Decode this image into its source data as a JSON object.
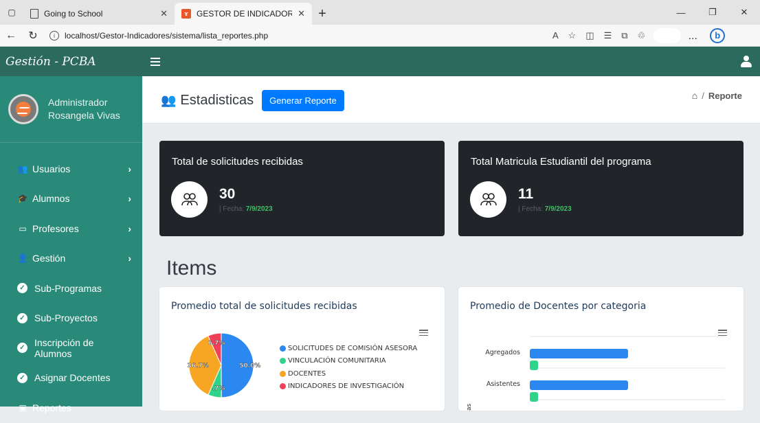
{
  "browser": {
    "tabs": [
      {
        "title": "Going to School",
        "active": false
      },
      {
        "title": "GESTOR DE INDICADORES",
        "active": true
      }
    ],
    "url": "localhost/Gestor-Indicadores/sistema/lista_reportes.php"
  },
  "brand": "Gestión - PCBA",
  "user": {
    "role": "Administrador",
    "name": "Rosangela Vivas"
  },
  "sidebar": {
    "items": [
      {
        "label": "Usuarios"
      },
      {
        "label": "Alumnos"
      },
      {
        "label": "Profesores"
      },
      {
        "label": "Gestión"
      },
      {
        "label": "Sub-Programas"
      },
      {
        "label": "Sub-Proyectos"
      },
      {
        "label": "Inscripción de Alumnos"
      },
      {
        "label": "Asignar Docentes"
      },
      {
        "label": "Reportes"
      }
    ]
  },
  "header": {
    "title": "Estadisticas",
    "generate_button": "Generar Reporte",
    "breadcrumb_sep": "/",
    "breadcrumb_current": "Reporte"
  },
  "stats": [
    {
      "title": "Total de solicitudes recibidas",
      "value": "30",
      "fecha_label": "| Fecha:",
      "date": "7/9/2023"
    },
    {
      "title": "Total Matricula Estudiantil del programa",
      "value": "11",
      "fecha_label": "| Fecha:",
      "date": "7/9/2023"
    }
  ],
  "items_heading": "Items",
  "charts": {
    "pie_title": "Promedio total de solicitudes recibidas",
    "bar_title": "Promedio de Docentes por categoria"
  },
  "chart_data": [
    {
      "type": "pie",
      "title": "Promedio total de solicitudes recibidas",
      "categories": [
        "SOLICITUDES DE COMISIÓN ASESORA",
        "VINCULACIÓN COMUNITARIA",
        "DOCENTES",
        "INDICADORES DE INVESTIGACIÓN"
      ],
      "values": [
        50.0,
        6.7,
        36.7,
        6.7
      ],
      "labels": [
        "50.0%",
        "6.7%",
        "36.7%",
        "6.7%"
      ],
      "colors": [
        "#2b88f0",
        "#2fd38a",
        "#f6a623",
        "#f2405a"
      ]
    },
    {
      "type": "bar",
      "orientation": "horizontal",
      "title": "Promedio de Docentes por categoria",
      "categories": [
        "Agregados",
        "Asistentes"
      ],
      "series": [
        {
          "color": "#2b88f0"
        },
        {
          "color": "#2fd38a"
        }
      ],
      "ylabel_partial": "as"
    }
  ]
}
